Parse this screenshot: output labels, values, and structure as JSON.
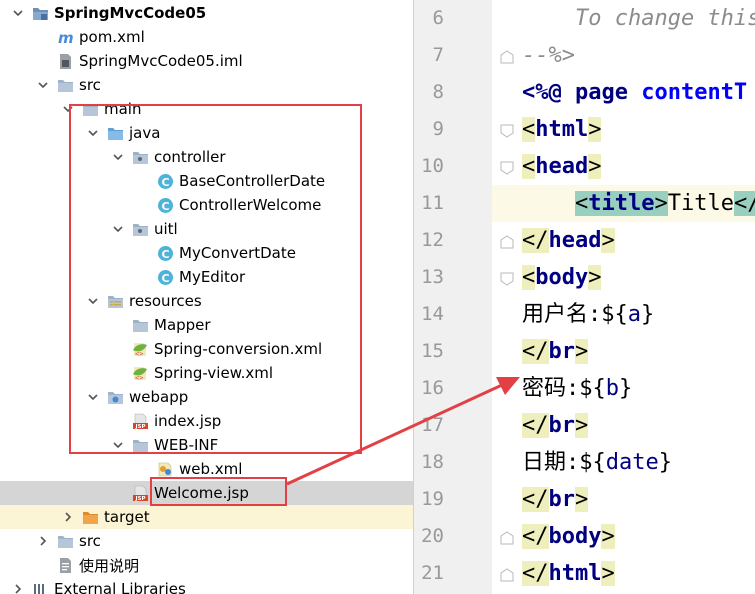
{
  "tree": {
    "items": [
      {
        "label": "SpringMvcCode05",
        "indent": 0,
        "arrow": "down",
        "icon": "module-folder-icon",
        "bold": true
      },
      {
        "label": "pom.xml",
        "indent": 1,
        "arrow": "none",
        "icon": "maven-icon"
      },
      {
        "label": "SpringMvcCode05.iml",
        "indent": 1,
        "arrow": "none",
        "icon": "iml-file-icon"
      },
      {
        "label": "src",
        "indent": 1,
        "arrow": "down",
        "icon": "folder-icon"
      },
      {
        "label": "main",
        "indent": 2,
        "arrow": "down",
        "icon": "folder-icon"
      },
      {
        "label": "java",
        "indent": 3,
        "arrow": "down",
        "icon": "source-folder-icon"
      },
      {
        "label": "controller",
        "indent": 4,
        "arrow": "down",
        "icon": "package-icon"
      },
      {
        "label": "BaseControllerDate",
        "indent": 5,
        "arrow": "none",
        "icon": "class-icon"
      },
      {
        "label": "ControllerWelcome",
        "indent": 5,
        "arrow": "none",
        "icon": "class-icon"
      },
      {
        "label": "uitl",
        "indent": 4,
        "arrow": "down",
        "icon": "package-icon"
      },
      {
        "label": "MyConvertDate",
        "indent": 5,
        "arrow": "none",
        "icon": "class-icon"
      },
      {
        "label": "MyEditor",
        "indent": 5,
        "arrow": "none",
        "icon": "class-icon"
      },
      {
        "label": "resources",
        "indent": 3,
        "arrow": "down",
        "icon": "resources-folder-icon"
      },
      {
        "label": "Mapper",
        "indent": 4,
        "arrow": "none",
        "icon": "folder-icon"
      },
      {
        "label": "Spring-conversion.xml",
        "indent": 4,
        "arrow": "none",
        "icon": "spring-xml-icon"
      },
      {
        "label": "Spring-view.xml",
        "indent": 4,
        "arrow": "none",
        "icon": "spring-xml-icon"
      },
      {
        "label": "webapp",
        "indent": 3,
        "arrow": "down",
        "icon": "web-folder-icon"
      },
      {
        "label": "index.jsp",
        "indent": 4,
        "arrow": "none",
        "icon": "jsp-icon"
      },
      {
        "label": "WEB-INF",
        "indent": 4,
        "arrow": "down",
        "icon": "folder-icon"
      },
      {
        "label": "web.xml",
        "indent": 5,
        "arrow": "none",
        "icon": "web-xml-icon"
      },
      {
        "label": "Welcome.jsp",
        "indent": 4,
        "arrow": "none",
        "icon": "jsp-icon",
        "selected": true
      },
      {
        "label": "target",
        "indent": 2,
        "arrow": "right",
        "icon": "excluded-folder-icon",
        "excluded": true
      },
      {
        "label": "src",
        "indent": 1,
        "arrow": "right",
        "icon": "folder-icon"
      },
      {
        "label": "使用说明",
        "indent": 1,
        "arrow": "none",
        "icon": "text-file-icon"
      },
      {
        "label": "External Libraries",
        "indent": 0,
        "arrow": "right",
        "icon": "libraries-icon"
      }
    ]
  },
  "editor": {
    "lines": [
      {
        "num": "6",
        "fold": "none",
        "tokens": [
          {
            "t": "    To change this t",
            "c": "t-comment"
          }
        ]
      },
      {
        "num": "7",
        "fold": "end",
        "tokens": [
          {
            "t": "--%>",
            "c": "t-comment"
          }
        ]
      },
      {
        "num": "8",
        "fold": "none",
        "tokens": [
          {
            "t": "<%@ ",
            "c": "t-directive"
          },
          {
            "t": "page ",
            "c": "t-directive"
          },
          {
            "t": "contentT",
            "c": "t-attr"
          }
        ]
      },
      {
        "num": "9",
        "fold": "start",
        "tokens": [
          {
            "t": "<",
            "c": "t-brk"
          },
          {
            "t": "html",
            "c": "t-tag"
          },
          {
            "t": ">",
            "c": "t-brk"
          }
        ]
      },
      {
        "num": "10",
        "fold": "start",
        "tokens": [
          {
            "t": "<",
            "c": "t-brk"
          },
          {
            "t": "head",
            "c": "t-tag"
          },
          {
            "t": ">",
            "c": "t-brk"
          }
        ]
      },
      {
        "num": "11",
        "fold": "none",
        "current": true,
        "tokens": [
          {
            "t": "    ",
            "c": "t-text"
          },
          {
            "t": "<",
            "c": "t-brk-hl"
          },
          {
            "t": "title",
            "c": "t-tag-hl"
          },
          {
            "t": ">",
            "c": "t-brk-hl"
          },
          {
            "t": "Title",
            "c": "t-text"
          },
          {
            "t": "</",
            "c": "t-brk-hl"
          }
        ]
      },
      {
        "num": "12",
        "fold": "end",
        "tokens": [
          {
            "t": "</",
            "c": "t-brk"
          },
          {
            "t": "head",
            "c": "t-tag"
          },
          {
            "t": ">",
            "c": "t-brk"
          }
        ]
      },
      {
        "num": "13",
        "fold": "start",
        "tokens": [
          {
            "t": "<",
            "c": "t-brk"
          },
          {
            "t": "body",
            "c": "t-tag"
          },
          {
            "t": ">",
            "c": "t-brk"
          }
        ]
      },
      {
        "num": "14",
        "fold": "none",
        "tokens": [
          {
            "t": "用户名:",
            "c": "t-text"
          },
          {
            "t": "${",
            "c": "t-dollar"
          },
          {
            "t": "a",
            "c": "t-el"
          },
          {
            "t": "}",
            "c": "t-dollar"
          }
        ]
      },
      {
        "num": "15",
        "fold": "none",
        "tokens": [
          {
            "t": "</",
            "c": "t-brk"
          },
          {
            "t": "br",
            "c": "t-tag"
          },
          {
            "t": ">",
            "c": "t-brk"
          }
        ]
      },
      {
        "num": "16",
        "fold": "none",
        "tokens": [
          {
            "t": "密码:",
            "c": "t-text"
          },
          {
            "t": "${",
            "c": "t-dollar"
          },
          {
            "t": "b",
            "c": "t-el"
          },
          {
            "t": "}",
            "c": "t-dollar"
          }
        ]
      },
      {
        "num": "17",
        "fold": "none",
        "tokens": [
          {
            "t": "</",
            "c": "t-brk"
          },
          {
            "t": "br",
            "c": "t-tag"
          },
          {
            "t": ">",
            "c": "t-brk"
          }
        ]
      },
      {
        "num": "18",
        "fold": "none",
        "tokens": [
          {
            "t": "日期:",
            "c": "t-text"
          },
          {
            "t": "${",
            "c": "t-dollar"
          },
          {
            "t": "date",
            "c": "t-el"
          },
          {
            "t": "}",
            "c": "t-dollar"
          }
        ]
      },
      {
        "num": "19",
        "fold": "none",
        "tokens": [
          {
            "t": "</",
            "c": "t-brk"
          },
          {
            "t": "br",
            "c": "t-tag"
          },
          {
            "t": ">",
            "c": "t-brk"
          }
        ]
      },
      {
        "num": "20",
        "fold": "end",
        "tokens": [
          {
            "t": "</",
            "c": "t-brk"
          },
          {
            "t": "body",
            "c": "t-tag"
          },
          {
            "t": ">",
            "c": "t-brk"
          }
        ]
      },
      {
        "num": "21",
        "fold": "end",
        "tokens": [
          {
            "t": "</",
            "c": "t-brk"
          },
          {
            "t": "html",
            "c": "t-tag"
          },
          {
            "t": ">",
            "c": "t-brk"
          }
        ]
      }
    ]
  },
  "annotation": {
    "color": "#e34046"
  }
}
